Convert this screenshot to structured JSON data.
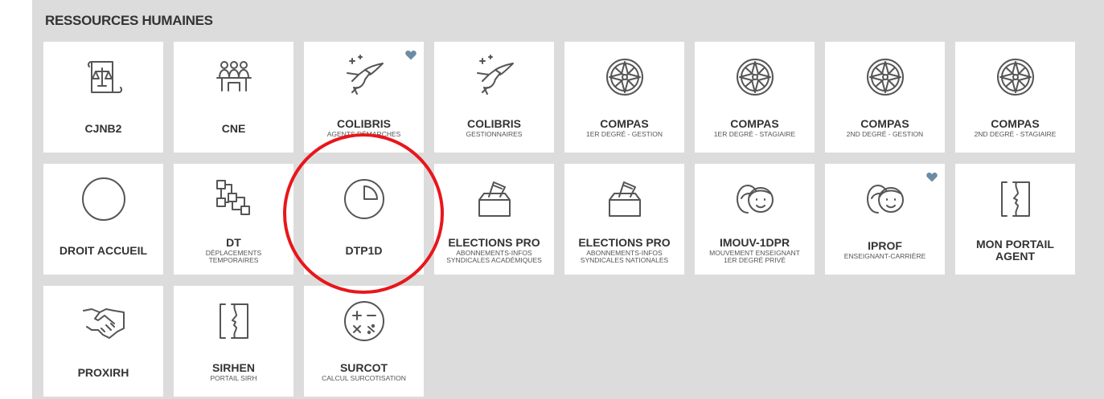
{
  "section": {
    "title": "RESSOURCES HUMAINES"
  },
  "tiles": [
    {
      "name": "CJNB2",
      "sub": "",
      "icon": "scales-scroll-icon",
      "favorite": false
    },
    {
      "name": "CNE",
      "sub": "",
      "icon": "meeting-people-icon",
      "favorite": false
    },
    {
      "name": "COLIBRIS",
      "sub": "AGENTS DÉMARCHES",
      "icon": "hummingbird-icon",
      "favorite": true
    },
    {
      "name": "COLIBRIS",
      "sub": "GESTIONNAIRES",
      "icon": "hummingbird-icon",
      "favorite": false
    },
    {
      "name": "COMPAS",
      "sub": "1ER DEGRÉ - GESTION",
      "icon": "compass-rose-icon",
      "favorite": false
    },
    {
      "name": "COMPAS",
      "sub": "1ER DEGRÉ - STAGIAIRE",
      "icon": "compass-rose-icon",
      "favorite": false
    },
    {
      "name": "COMPAS",
      "sub": "2ND DEGRÉ - GESTION",
      "icon": "compass-rose-icon",
      "favorite": false
    },
    {
      "name": "COMPAS",
      "sub": "2ND DEGRÉ - STAGIAIRE",
      "icon": "compass-rose-icon",
      "favorite": false
    },
    {
      "name": "DROIT ACCUEIL",
      "sub": "",
      "icon": "circle-icon",
      "favorite": false
    },
    {
      "name": "DT",
      "sub": "DÉPLACEMENTS TEMPORAIRES",
      "icon": "network-boxes-icon",
      "favorite": false
    },
    {
      "name": "DTP1D",
      "sub": "",
      "icon": "pie-clock-icon",
      "favorite": false
    },
    {
      "name": "ELECTIONS PRO",
      "sub": "ABONNEMENTS-INFOS SYNDICALES ACADÉMIQUES",
      "icon": "ballot-box-icon",
      "favorite": false
    },
    {
      "name": "ELECTIONS PRO",
      "sub": "ABONNEMENTS-INFOS SYNDICALES NATIONALES",
      "icon": "ballot-box-icon",
      "favorite": false
    },
    {
      "name": "IMOUV-1DPR",
      "sub": "MOUVEMENT ENSEIGNANT 1ER DEGRÉ PRIVÉ",
      "icon": "two-faces-icon",
      "favorite": false
    },
    {
      "name": "IPROF",
      "sub": "ENSEIGNANT-CARRIÈRE",
      "icon": "two-faces-icon",
      "favorite": true
    },
    {
      "name": "MON PORTAIL AGENT",
      "sub": "",
      "icon": "profile-frame-icon",
      "favorite": false
    },
    {
      "name": "PROXIRH",
      "sub": "",
      "icon": "handshake-icon",
      "favorite": false
    },
    {
      "name": "SIRHEN",
      "sub": "PORTAIL SIRH",
      "icon": "profile-frame-icon",
      "favorite": false
    },
    {
      "name": "SURCOT",
      "sub": "CALCUL SURCOTISATION",
      "icon": "calculator-ops-icon",
      "favorite": false
    }
  ],
  "colors": {
    "panel": "#dcdcdc",
    "tile": "#ffffff",
    "heart": "#6a8ca6",
    "highlight": "#e8161b",
    "icon_stroke": "#555555"
  }
}
